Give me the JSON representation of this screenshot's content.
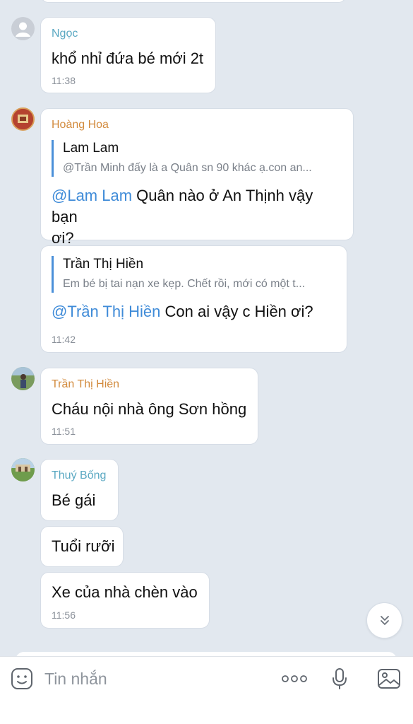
{
  "messages": [
    {
      "sender": "Ngọc",
      "sender_color": "#5aa8c2",
      "text": "khổ nhỉ đứa bé mới 2t",
      "time": "11:38"
    },
    {
      "sender": "Hoàng Hoa",
      "sender_color": "#d28a3c",
      "quote_name": "Lam Lam",
      "quote_text": "@Trần Minh đấy là a Quân sn 90 khác ạ.con an...",
      "mention": "@Lam Lam",
      "text_line1": " Quân nào ở An Thịnh vậy bạn",
      "text_line2": "ơi?"
    },
    {
      "quote_name": "Trần Thị Hiền",
      "quote_text": "Em bé bị tai nạn xe kẹp. Chết rồi, mới có một t...",
      "mention": "@Trần Thị Hiền",
      "text": " Con ai vậy c Hiền ơi?",
      "time": "11:42"
    },
    {
      "sender": "Trần Thị Hiền",
      "sender_color": "#d28a3c",
      "text": "Cháu nội nhà ông Sơn hồng",
      "time": "11:51"
    },
    {
      "sender": "Thuý Bống",
      "sender_color": "#5aa8c2",
      "text": "Bé gái"
    },
    {
      "text": "Tuổi rưỡi"
    },
    {
      "text": "Xe của nhà chèn vào",
      "time": "11:56"
    }
  ],
  "composer": {
    "placeholder": "Tin nhắn"
  }
}
